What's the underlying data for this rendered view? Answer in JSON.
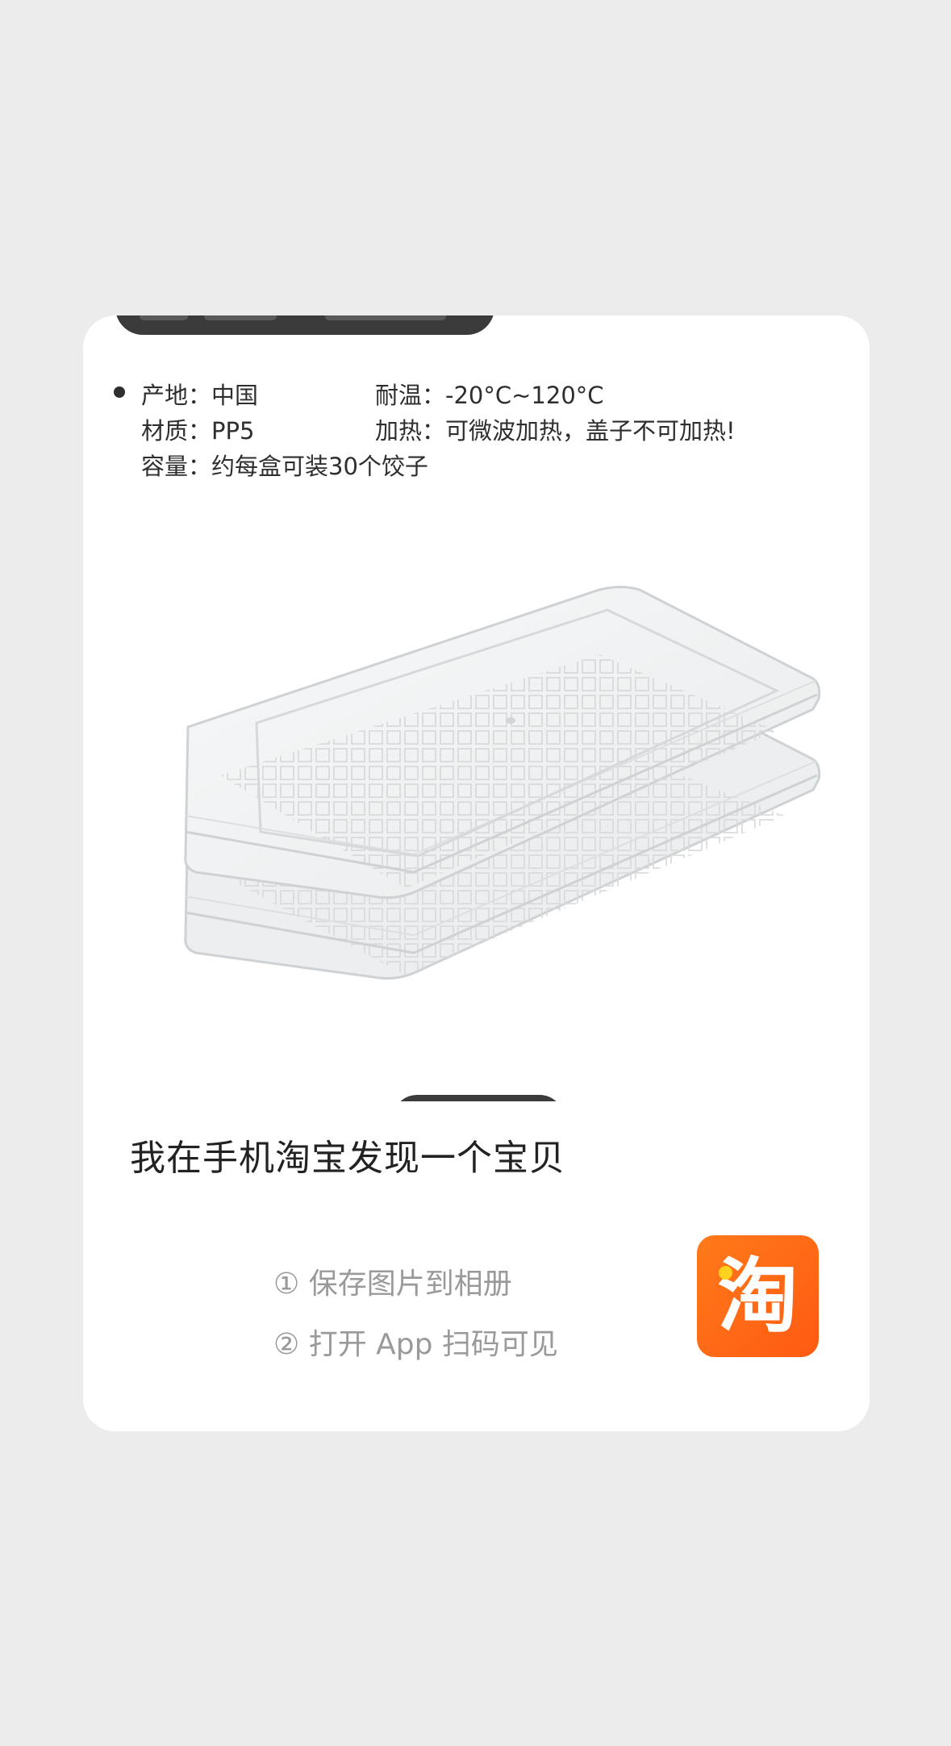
{
  "product_specs": {
    "origin": "产地：中国",
    "temperature": "耐温：-20°C~120°C",
    "material": "材质：PP5",
    "heating": "加热：可微波加热，盖子不可加热!",
    "capacity": "容量：约每盒可装30个饺子"
  },
  "product_image": {
    "icon": "stacked-crisper-trays-image"
  },
  "share": {
    "title": "我在手机淘宝发现一个宝贝",
    "step1": "① 保存图片到相册",
    "step2": "② 打开 App 扫码可见",
    "app_logo_glyph": "淘",
    "app_logo_icon": "taobao-logo-icon",
    "brand_color": "#ff5f14",
    "brand_dot_color": "#ffd21f"
  },
  "colors": {
    "background": "#ececec",
    "card": "#ffffff",
    "pill": "#3b3b3b"
  }
}
